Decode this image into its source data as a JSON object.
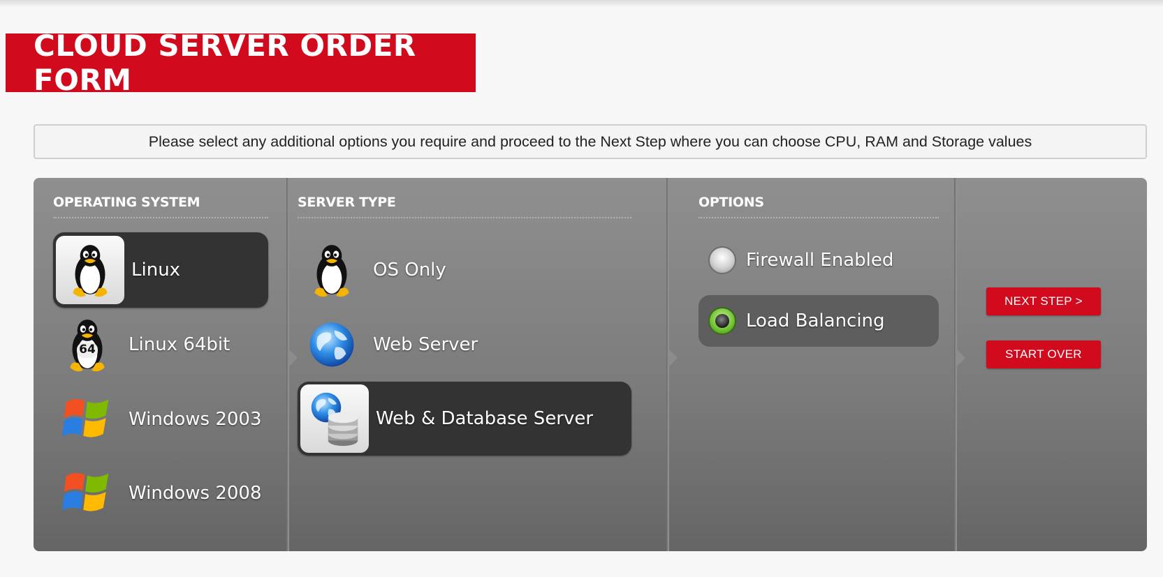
{
  "title": "CLOUD SERVER ORDER FORM",
  "notice": "Please select any additional options you require and proceed to the Next Step where you can choose CPU, RAM and Storage values",
  "os": {
    "heading": "OPERATING SYSTEM",
    "items": [
      {
        "label": "Linux",
        "icon": "tux-penguin-icon",
        "selected": true
      },
      {
        "label": "Linux 64bit",
        "icon": "tux-64-penguin-icon",
        "selected": false
      },
      {
        "label": "Windows 2003",
        "icon": "windows-logo-icon",
        "selected": false
      },
      {
        "label": "Windows 2008",
        "icon": "windows-logo-icon",
        "selected": false
      }
    ]
  },
  "server_type": {
    "heading": "SERVER TYPE",
    "items": [
      {
        "label": "OS Only",
        "icon": "tux-penguin-icon",
        "selected": false
      },
      {
        "label": "Web Server",
        "icon": "globe-icon",
        "selected": false
      },
      {
        "label": "Web & Database Server",
        "icon": "globe-database-icon",
        "selected": true
      }
    ]
  },
  "options": {
    "heading": "OPTIONS",
    "items": [
      {
        "label": "Firewall Enabled",
        "selected": false
      },
      {
        "label": "Load Balancing",
        "selected": true
      }
    ]
  },
  "buttons": {
    "next": "NEXT STEP >",
    "start_over": "START OVER"
  },
  "colors": {
    "brand_red": "#d10a1e",
    "panel_gray": "#808080",
    "selected_dark": "#333333"
  }
}
